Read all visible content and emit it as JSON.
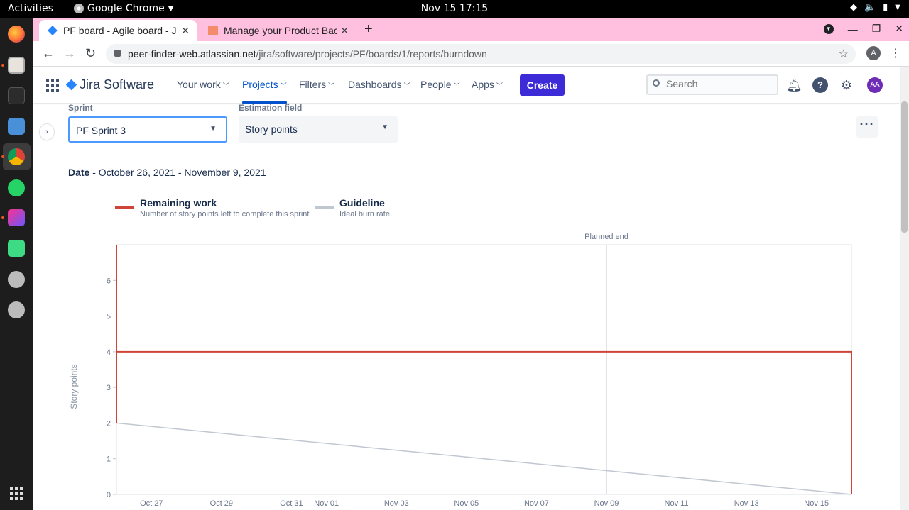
{
  "os": {
    "activities": "Activities",
    "app_menu": "Google Chrome",
    "clock": "Nov 15  17:15"
  },
  "browser": {
    "tabs": [
      {
        "title": "PF board - Agile board - Jira"
      },
      {
        "title": "Manage your Product Backlog"
      }
    ],
    "url_host": "peer-finder-web.atlassian.net",
    "url_path": "/jira/software/projects/PF/boards/1/reports/burndown",
    "profile_initial": "A"
  },
  "jira": {
    "product": "Jira Software",
    "menu": {
      "your_work": "Your work",
      "projects": "Projects",
      "filters": "Filters",
      "dashboards": "Dashboards",
      "people": "People",
      "apps": "Apps"
    },
    "create": "Create",
    "search_placeholder": "Search",
    "avatar": "AA"
  },
  "report": {
    "sprint_label": "Sprint",
    "sprint_value": "PF Sprint 3",
    "estimation_label": "Estimation field",
    "estimation_value": "Story points",
    "date_label": "Date",
    "date_range": " - October 26, 2021 - November 9, 2021",
    "legend": {
      "remaining_name": "Remaining work",
      "remaining_desc": "Number of story points left to complete this sprint",
      "guideline_name": "Guideline",
      "guideline_desc": "Ideal burn rate"
    }
  },
  "colors": {
    "remaining": "#d04437",
    "guideline": "#c1c7d0",
    "brand": "#0052cc",
    "create": "#3d2bd8"
  },
  "chart_data": {
    "type": "line",
    "ylabel": "Story points",
    "ylim": [
      0,
      7
    ],
    "yticks": [
      0,
      1,
      2,
      3,
      4,
      5,
      6
    ],
    "xlim": [
      "2021-10-26",
      "2021-11-16"
    ],
    "xticks": [
      {
        "date": "2021-10-27",
        "label": "Oct 27"
      },
      {
        "date": "2021-10-29",
        "label": "Oct 29"
      },
      {
        "date": "2021-10-31",
        "label": "Oct 31"
      },
      {
        "date": "2021-11-01",
        "label": "Nov 01"
      },
      {
        "date": "2021-11-03",
        "label": "Nov 03"
      },
      {
        "date": "2021-11-05",
        "label": "Nov 05"
      },
      {
        "date": "2021-11-07",
        "label": "Nov 07"
      },
      {
        "date": "2021-11-09",
        "label": "Nov 09"
      },
      {
        "date": "2021-11-11",
        "label": "Nov 11"
      },
      {
        "date": "2021-11-13",
        "label": "Nov 13"
      },
      {
        "date": "2021-11-15",
        "label": "Nov 15"
      }
    ],
    "planned_end": {
      "date": "2021-11-09",
      "label": "Planned end"
    },
    "series": [
      {
        "name": "Remaining work",
        "points": [
          {
            "x": "2021-10-26",
            "y": 7
          },
          {
            "x": "2021-10-26",
            "y": 2
          },
          {
            "x": "2021-10-26",
            "y": 4
          },
          {
            "x": "2021-11-16",
            "y": 4
          },
          {
            "x": "2021-11-16",
            "y": 0
          }
        ]
      },
      {
        "name": "Guideline",
        "points": [
          {
            "x": "2021-10-26",
            "y": 2
          },
          {
            "x": "2021-11-16",
            "y": 0
          }
        ]
      }
    ]
  }
}
